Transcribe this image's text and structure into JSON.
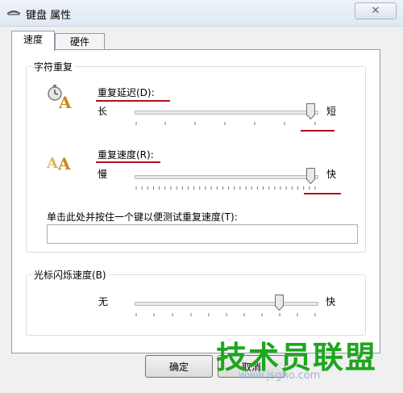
{
  "window": {
    "title": "键盘 属性",
    "close_glyph": "✕"
  },
  "tabs": [
    {
      "label": "速度",
      "active": true
    },
    {
      "label": "硬件",
      "active": false
    }
  ],
  "repeat_group": {
    "legend": "字符重复",
    "delay": {
      "label": "重复延迟(D):",
      "left": "长",
      "right": "短",
      "level": 1.0
    },
    "rate": {
      "label": "重复速度(R):",
      "left": "慢",
      "right": "快",
      "level": 1.0
    },
    "test_label": "单击此处并按住一个键以便测试重复速度(T):",
    "test_value": ""
  },
  "cursor_group": {
    "legend": "光标闪烁速度(B)",
    "left": "无",
    "right": "快",
    "level": 0.8
  },
  "buttons": {
    "ok": "确定",
    "cancel": "取消"
  },
  "watermark": {
    "text": "技术员联盟",
    "url": "www.jsgho.com"
  },
  "colors": {
    "accent_underline": "#b2101a",
    "watermark": "#1fa51f"
  },
  "icons": {
    "delay": "stopwatch-letter-icon",
    "rate": "letters-icon",
    "title": "keyboard-icon"
  }
}
